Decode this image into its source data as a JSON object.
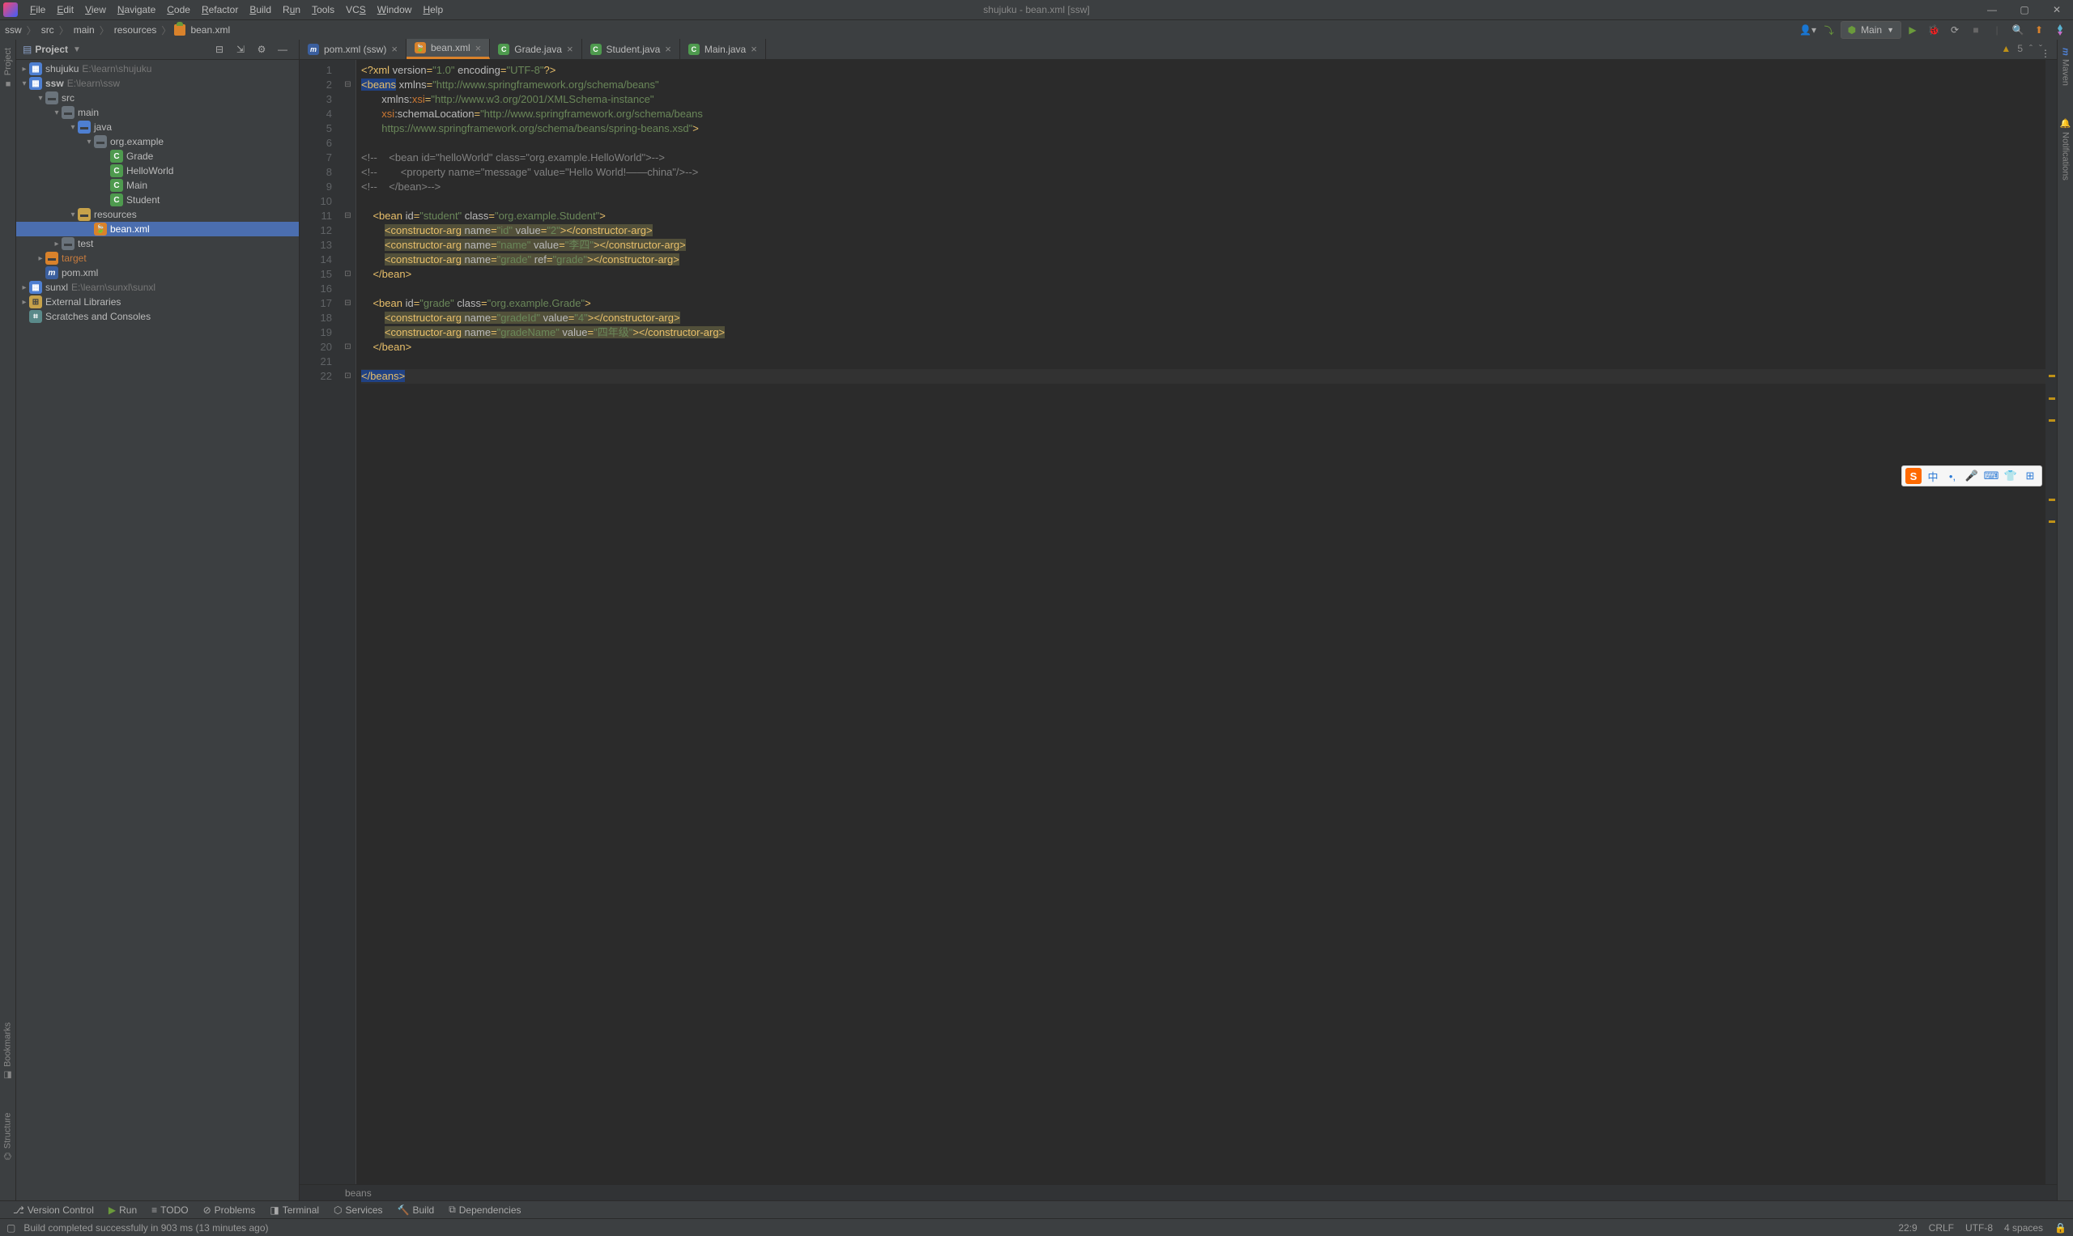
{
  "window": {
    "title": "shujuku - bean.xml [ssw]"
  },
  "menu": {
    "file": "File",
    "edit": "Edit",
    "view": "View",
    "navigate": "Navigate",
    "code": "Code",
    "refactor": "Refactor",
    "build": "Build",
    "run": "Run",
    "tools": "Tools",
    "vcs": "VCS",
    "window": "Window",
    "help": "Help"
  },
  "breadcrumbs": [
    "ssw",
    "src",
    "main",
    "resources",
    "bean.xml"
  ],
  "run_config": "Main",
  "project_panel": {
    "title": "Project"
  },
  "tree": {
    "shujuku": {
      "name": "shujuku",
      "path": "E:\\learn\\shujuku"
    },
    "ssw": {
      "name": "ssw",
      "path": "E:\\learn\\ssw"
    },
    "src": "src",
    "main": "main",
    "java": "java",
    "pkg": "org.example",
    "grade": "Grade",
    "hello": "HelloWorld",
    "mainc": "Main",
    "student": "Student",
    "resources": "resources",
    "bean": "bean.xml",
    "test": "test",
    "target": "target",
    "pom": "pom.xml",
    "sunxl": {
      "name": "sunxl",
      "path": "E:\\learn\\sunxl\\sunxl"
    },
    "ext": "External Libraries",
    "scratch": "Scratches and Consoles"
  },
  "tabs": [
    {
      "label": "pom.xml (ssw)",
      "icon": "m",
      "iconClass": "ic-m"
    },
    {
      "label": "bean.xml",
      "icon": "x",
      "iconClass": "ic-xml",
      "active": true
    },
    {
      "label": "Grade.java",
      "icon": "C",
      "iconClass": "ic-class"
    },
    {
      "label": "Student.java",
      "icon": "C",
      "iconClass": "ic-class"
    },
    {
      "label": "Main.java",
      "icon": "C",
      "iconClass": "ic-class"
    }
  ],
  "code": {
    "l1": {
      "pi": "<?xml",
      "a1": " version",
      "v1": "\"1.0\"",
      "a2": " encoding",
      "v2": "\"UTF-8\"",
      "end": "?>"
    },
    "l2": {
      "tag": "<beans",
      "a": " xmlns",
      "v": "\"http://www.springframework.org/schema/beans\""
    },
    "l3": {
      "pre": "       ",
      "a": "xmlns:",
      "ns": "xsi",
      "v": "\"http://www.w3.org/2001/XMLSchema-instance\""
    },
    "l4": {
      "pre": "       ",
      "ns": "xsi",
      "a": ":schemaLocation",
      "v": "\"http://www.springframework.org/schema/beans"
    },
    "l5": {
      "pre": "       ",
      "v": "https://www.springframework.org/schema/beans/spring-beans.xsd\"",
      "end": ">"
    },
    "l7": "<!--    <bean id=\"helloWorld\" class=\"org.example.HelloWorld\">-->",
    "l8": "<!--        <property name=\"message\" value=\"Hello World!——china\"/>-->",
    "l9": "<!--    </bean>-->",
    "l11": {
      "tag": "<bean",
      "a1": " id",
      "v1": "\"student\"",
      "a2": " class",
      "v2": "\"org.example.Student\"",
      "end": ">"
    },
    "l12": {
      "tag": "<constructor-arg",
      "a1": " name",
      "v1": "\"id\"",
      "a2": " value",
      "v2": "\"2\"",
      "end": "></constructor-arg>"
    },
    "l13": {
      "tag": "<constructor-arg",
      "a1": " name",
      "v1": "\"name\"",
      "a2": " value",
      "v2": "\"李四\"",
      "end": "></constructor-arg>"
    },
    "l14": {
      "tag": "<constructor-arg",
      "a1": " name",
      "v1": "\"grade\"",
      "a2": " ref",
      "v2": "\"grade\"",
      "end": "></constructor-arg>"
    },
    "l15": "</bean>",
    "l17": {
      "tag": "<bean",
      "a1": " id",
      "v1": "\"grade\"",
      "a2": " class",
      "v2": "\"org.example.Grade\"",
      "end": ">"
    },
    "l18": {
      "tag": "<constructor-arg",
      "a1": " name",
      "v1": "\"gradeId\"",
      "a2": " value",
      "v2": "\"4\"",
      "end": "></constructor-arg>"
    },
    "l19": {
      "tag": "<constructor-arg",
      "a1": " name",
      "v1": "\"gradeName\"",
      "a2": " value",
      "v2": "\"四年级\"",
      "end": "></constructor-arg>"
    },
    "l20": "</bean>",
    "l22": "</beans>"
  },
  "editor_crumb": "beans",
  "warnings": "5",
  "tool_windows": {
    "l_project": "Project",
    "l_bookmarks": "Bookmarks",
    "l_structure": "Structure",
    "r_maven": "Maven",
    "r_notifications": "Notifications",
    "b_version": "Version Control",
    "b_run": "Run",
    "b_todo": "TODO",
    "b_problems": "Problems",
    "b_terminal": "Terminal",
    "b_services": "Services",
    "b_build": "Build",
    "b_deps": "Dependencies"
  },
  "status": {
    "msg": "Build completed successfully in 903 ms (13 minutes ago)",
    "pos": "22:9",
    "sep": "CRLF",
    "enc": "UTF-8",
    "indent": "4 spaces"
  },
  "ime": [
    "S",
    "中",
    "•,",
    "🎤",
    "⌨",
    "👕",
    "⊞"
  ]
}
